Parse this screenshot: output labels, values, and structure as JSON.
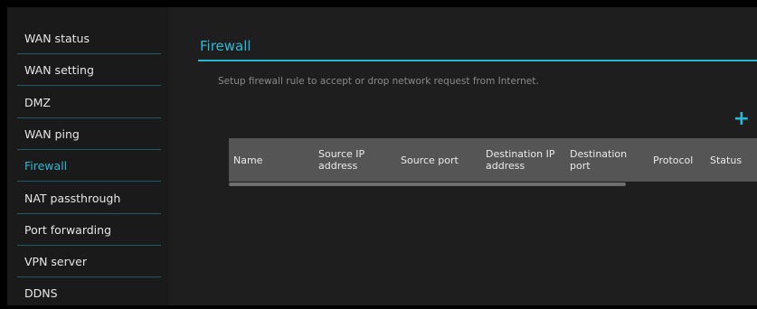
{
  "sidebar": {
    "items": [
      {
        "label": "WAN status"
      },
      {
        "label": "WAN setting"
      },
      {
        "label": "DMZ"
      },
      {
        "label": "WAN ping"
      },
      {
        "label": "Firewall",
        "active": true
      },
      {
        "label": "NAT passthrough"
      },
      {
        "label": "Port forwarding"
      },
      {
        "label": "VPN server"
      },
      {
        "label": "DDNS"
      }
    ]
  },
  "main": {
    "title": "Firewall",
    "description": "Setup firewall rule to accept or drop network request from Internet.",
    "add_icon": "+",
    "table": {
      "columns": [
        {
          "label": "Name"
        },
        {
          "label": "Source IP address"
        },
        {
          "label": "Source port"
        },
        {
          "label": "Destination IP address"
        },
        {
          "label": "Destination port"
        },
        {
          "label": "Protocol"
        },
        {
          "label": "Status"
        }
      ],
      "rows": []
    }
  },
  "colors": {
    "accent": "#2ab8d6",
    "sidebar_bg": "#1a1a1a",
    "main_bg": "#1e1e1e",
    "table_header_bg": "#555555"
  }
}
